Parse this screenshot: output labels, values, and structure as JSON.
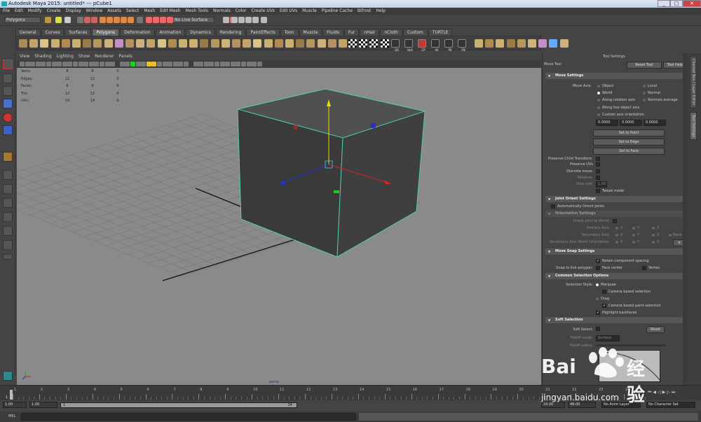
{
  "window": {
    "title": "Autodesk Maya 2015: untitled*   ---   pCube1",
    "controls": [
      "_",
      "□",
      "✕"
    ]
  },
  "menus": [
    "File",
    "Edit",
    "Modify",
    "Create",
    "Display",
    "Window",
    "Assets",
    "Select",
    "Mesh",
    "Edit Mesh",
    "Mesh Tools",
    "Normals",
    "Color",
    "Create UVs",
    "Edit UVs",
    "Muscle",
    "Pipeline Cache",
    "Bifrost",
    "Help"
  ],
  "statusline": {
    "mode": "Polygons",
    "live_surface": "No Live Surface"
  },
  "shelf_tabs": [
    "General",
    "Curves",
    "Surfaces",
    "Polygons",
    "Deformation",
    "Animation",
    "Dynamics",
    "Rendering",
    "PaintEffects",
    "Toon",
    "Muscle",
    "Fluids",
    "Fur",
    "nHair",
    "nCloth",
    "Custom",
    "TURTLE"
  ],
  "shelf_active": "Polygons",
  "shelf_labels": [
    "DS",
    "Hist",
    "CP",
    "All",
    "PS",
    "FN"
  ],
  "viewport": {
    "menu": [
      "View",
      "Shading",
      "Lighting",
      "Show",
      "Renderer",
      "Panels"
    ],
    "hud": [
      {
        "label": "Verts:",
        "v": [
          "8",
          "8",
          "0"
        ]
      },
      {
        "label": "Edges:",
        "v": [
          "12",
          "12",
          "0"
        ]
      },
      {
        "label": "Faces:",
        "v": [
          "6",
          "6",
          "0"
        ]
      },
      {
        "label": "Tris:",
        "v": [
          "12",
          "12",
          "0"
        ]
      },
      {
        "label": "UVs:",
        "v": [
          "14",
          "14",
          "0"
        ]
      }
    ],
    "camera": "persp"
  },
  "tool_settings": {
    "panel_title": "Tool Settings",
    "tool_name": "Move Tool",
    "reset_tool": "Reset Tool",
    "tool_help": "Tool Help",
    "move_settings": "Move Settings",
    "move_axis_label": "Move Axis:",
    "axis_options": [
      "Object",
      "Local",
      "World",
      "Normal",
      "Along rotation axis",
      "Normals average",
      "Along live object axis",
      "Custom axis orientation"
    ],
    "custom_values": [
      "0.0000",
      "0.0000",
      "0.0000"
    ],
    "set_to_point": "Set to Point",
    "set_to_edge": "Set to Edge",
    "set_to_face": "Set to Face",
    "preserve_child": "Preserve Child Transform",
    "preserve_uvs": "Preserve UVs",
    "discrete_move": "Discrete move:",
    "relative": "Relative:",
    "step_size": "Step size:",
    "step_value": "1.00",
    "tweak_mode": "Tweak mode",
    "joint_orient": "Joint Orient Settings",
    "auto_orient": "Automatically Orient Joints",
    "orientation_settings": "Orientation Settings",
    "orient_to_world": "Orient Joint to World:",
    "primary_axis": "Primary Axis:",
    "secondary_axis": "Secondary Axis:",
    "secondary_world": "Secondary Axis World Orientation:",
    "xyz": [
      "X",
      "Y",
      "Z"
    ],
    "none": "None",
    "move_snap": "Move Snap Settings",
    "retain_spacing": "Retain component spacing",
    "snap_live": "Snap to live polygon:",
    "face_center": "Face center",
    "vertex": "Vertex",
    "common_sel": "Common Selection Options",
    "sel_style": "Selection Style:",
    "marquee": "Marquee",
    "camera_sel": "Camera based selection",
    "drag": "Drag",
    "camera_paint": "Camera based paint selection",
    "highlight_back": "Highlight backfaces",
    "soft_sel": "Soft Selection",
    "soft_select": "Soft Select:",
    "reset": "Reset",
    "falloff_mode": "Falloff mode:",
    "falloff_value": "Surface",
    "falloff_radius": "Falloff radius:"
  },
  "side_tabs": [
    "Channel Box / Layer Editor",
    "Tool Settings"
  ],
  "timeline": {
    "ticks": [
      "1",
      "2",
      "3",
      "4",
      "5",
      "6",
      "7",
      "8",
      "9",
      "10",
      "11",
      "12",
      "13",
      "14",
      "15",
      "16",
      "17",
      "18",
      "19",
      "20",
      "21",
      "22",
      "23",
      "24"
    ],
    "current": "1",
    "end_frame": "24"
  },
  "range": {
    "start": "1.00",
    "start2": "1.00",
    "slider_start": "1",
    "slider_end": "24",
    "end": "24.00",
    "end2": "48.00",
    "anim_layer": "No Anim Layer",
    "char_set": "No Character Set"
  },
  "command": {
    "lang": "MEL"
  },
  "watermark": {
    "brand": "Bai",
    "brand2": "经验",
    "url": "jingyan.baidu.com"
  }
}
